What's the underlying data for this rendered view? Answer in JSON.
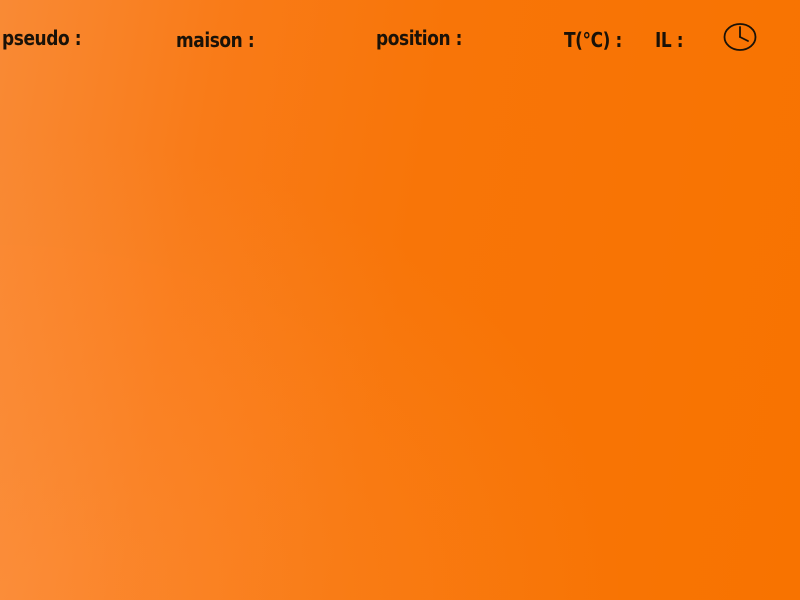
{
  "header": {
    "pseudo_label": "pseudo :",
    "maison_label": "maison :",
    "position_label": "position :",
    "temperature_label": "T(°C) :",
    "il_label": "IL :",
    "clock_icon": "clock-icon"
  },
  "colors": {
    "background": "#f87508",
    "text": "#1a1208"
  }
}
